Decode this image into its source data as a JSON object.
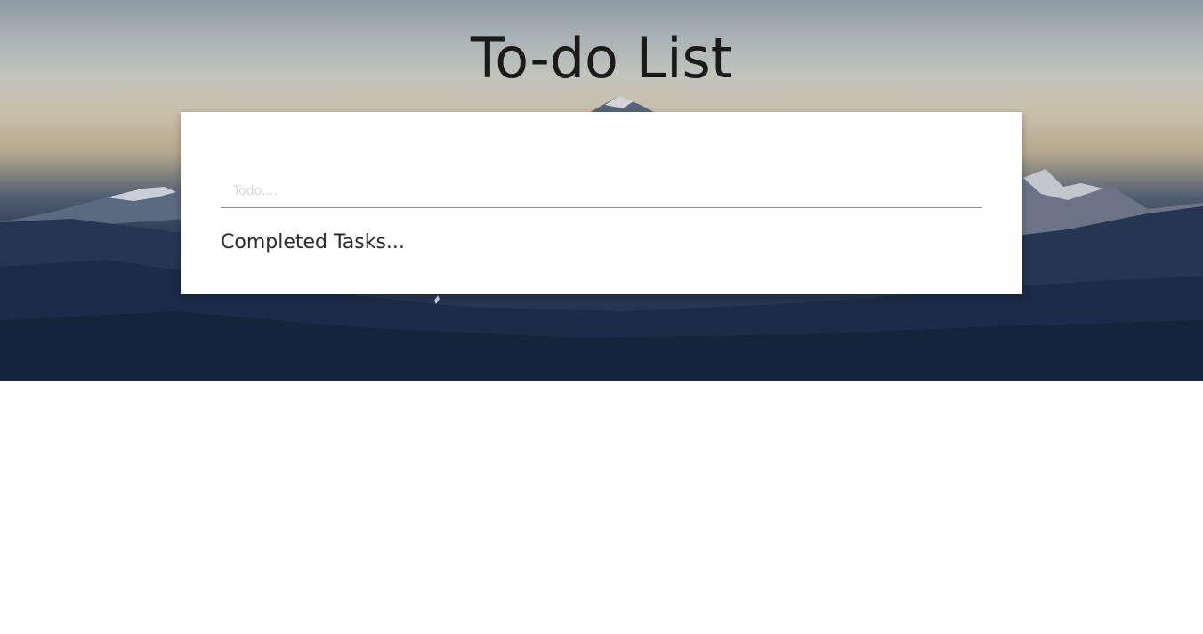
{
  "header": {
    "title": "To-do List"
  },
  "todo": {
    "input_value": "",
    "input_placeholder": "Todo...."
  },
  "completed": {
    "heading": "Completed Tasks..."
  },
  "background": {
    "image": "mountain-landscape-at-dusk"
  }
}
